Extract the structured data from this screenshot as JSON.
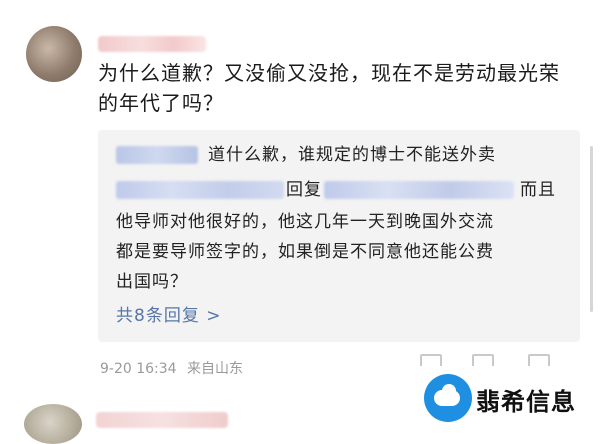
{
  "comment": {
    "text": "为什么道歉？又没偷又没抢，现在不是劳动最光荣的年代了吗？"
  },
  "replies": {
    "line1": "道什么歉，谁规定的博士不能送外卖",
    "line2_mid": "回复",
    "line2_end": "而且",
    "line3": "他导师对他很好的，他这几年一天到晚国外交流",
    "line4": "都是要导师签字的，如果倒是不同意他还能公费",
    "line5": "出国吗？",
    "more": "共8条回复 >"
  },
  "meta": {
    "time": "9-20 16:34",
    "source": "来自山东"
  },
  "watermark": {
    "text": "翡希信息"
  },
  "colors": {
    "link": "#5776a8",
    "quote_bg": "#f3f3f3",
    "meta": "#9a9a9a",
    "brand_blue": "#1e8fe1"
  }
}
